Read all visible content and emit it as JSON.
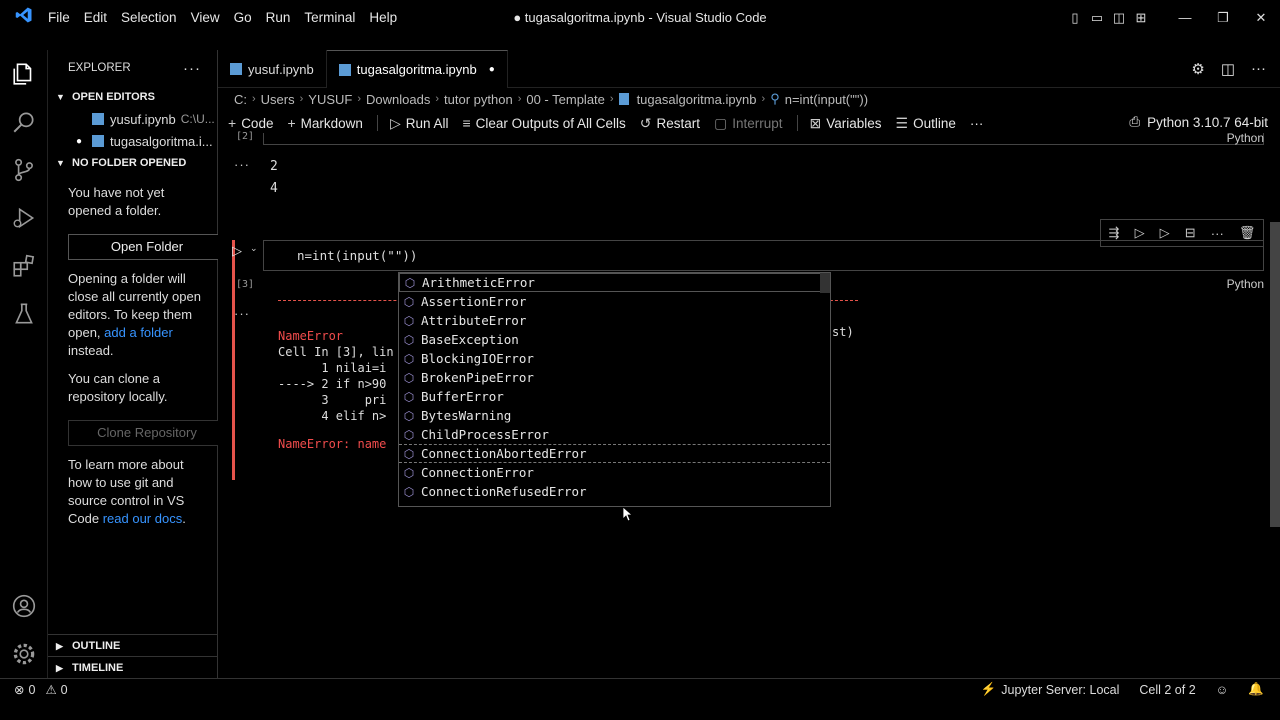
{
  "app": {
    "window_title": "● tugasalgoritma.ipynb - Visual Studio Code"
  },
  "menu": [
    "File",
    "Edit",
    "Selection",
    "View",
    "Go",
    "Run",
    "Terminal",
    "Help"
  ],
  "sidebar": {
    "title": "EXPLORER",
    "open_editors_label": "OPEN EDITORS",
    "open_editors": [
      {
        "name": "yusuf.ipynb",
        "path": "C:\\U..."
      },
      {
        "name": "tugasalgoritma.i...",
        "path": ""
      }
    ],
    "no_folder_label": "NO FOLDER OPENED",
    "msg1": "You have not yet opened a folder.",
    "open_folder_btn": "Open Folder",
    "msg2_pre": "Opening a folder will close all currently open editors. To keep them open,",
    "msg2_link": "add a folder",
    "msg2_post": "instead.",
    "msg3": "You can clone a repository locally.",
    "clone_btn": "Clone Repository",
    "msg4_pre": "To learn more about how to use git and source control in VS Code",
    "msg4_link": "read our docs",
    "msg4_post": ".",
    "outline_label": "OUTLINE",
    "timeline_label": "TIMELINE"
  },
  "tabs": [
    {
      "label": "yusuf.ipynb"
    },
    {
      "label": "tugasalgoritma.ipynb",
      "dirty_mark": "●"
    }
  ],
  "breadcrumb": [
    "C:",
    "Users",
    "YUSUF",
    "Downloads",
    "tutor python",
    "00 - Template",
    "tugasalgoritma.ipynb",
    "n=int(input(\"\"))"
  ],
  "toolbar": {
    "code": "Code",
    "markdown": "Markdown",
    "run_all": "Run All",
    "clear_outputs": "Clear Outputs of All Cells",
    "restart": "Restart",
    "interrupt": "Interrupt",
    "variables": "Variables",
    "outline": "Outline",
    "more": "···",
    "kernel": "Python 3.10.7 64-bit"
  },
  "cells": {
    "prev_exec": "[2]",
    "prev_lang": "Python",
    "prev_outputs": [
      "2",
      "4"
    ],
    "out_ellipsis": "···",
    "current_code": "n=int(input(\"\"))",
    "current_exec": "[3]",
    "current_lang": "Python",
    "error_lines": [
      {
        "text": "NameError",
        "color": "#f14c4c"
      },
      {
        "text": "Cell In [3], lin",
        "color": "#dddddd"
      },
      {
        "text": "      1 nilai=i",
        "color": "#dddddd"
      },
      {
        "text": "----> 2 if n>90",
        "color": "#dddddd"
      },
      {
        "text": "      3     pri",
        "color": "#dddddd"
      },
      {
        "text": "      4 elif n>",
        "color": "#dddddd"
      }
    ],
    "error_tail": "st)",
    "error_final": "NameError: name"
  },
  "suggestions": [
    "ArithmeticError",
    "AssertionError",
    "AttributeError",
    "BaseException",
    "BlockingIOError",
    "BrokenPipeError",
    "BufferError",
    "BytesWarning",
    "ChildProcessError",
    "ConnectionAbortedError",
    "ConnectionError",
    "ConnectionRefusedError"
  ],
  "status": {
    "errors": "0",
    "warnings": "0",
    "jupyter": "Jupyter Server: Local",
    "cell_pos": "Cell 2 of 2"
  },
  "colors": {
    "accent": "#3794ff",
    "error": "#f14c4c",
    "highlight": "#e5c07b"
  }
}
